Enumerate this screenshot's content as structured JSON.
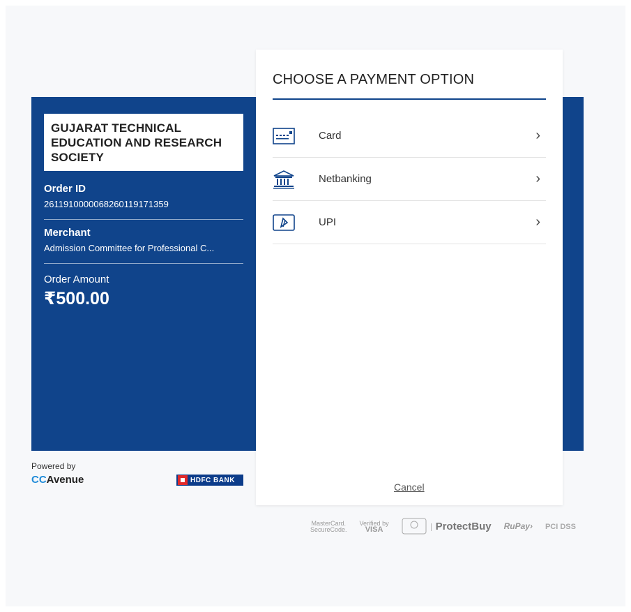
{
  "merchant_box": {
    "name": "GUJARAT TECHNICAL EDUCATION AND RESEARCH SOCIETY"
  },
  "order": {
    "id_label": "Order ID",
    "id_value": "2611910000068260119171359"
  },
  "merchant": {
    "label": "Merchant",
    "value": "Admission Committee for Professional C..."
  },
  "amount": {
    "label": "Order Amount",
    "value": "₹500.00"
  },
  "footer": {
    "powered_by": "Powered by",
    "cc_part": "CC",
    "avenue_part": "Avenue",
    "hdfc": "HDFC BANK"
  },
  "panel": {
    "title": "CHOOSE A PAYMENT OPTION",
    "options": [
      {
        "label": "Card",
        "icon": "card-icon"
      },
      {
        "label": "Netbanking",
        "icon": "bank-icon"
      },
      {
        "label": "UPI",
        "icon": "upi-icon"
      }
    ],
    "cancel": "Cancel"
  },
  "security_logos": {
    "mastercard_l1": "MasterCard.",
    "mastercard_l2": "SecureCode.",
    "visa_l1": "Verified by",
    "visa_l2": "VISA",
    "protectbuy": "ProtectBuy",
    "rupay": "RuPay›",
    "pci": "PCI DSS"
  },
  "colors": {
    "brand_blue": "#10448b",
    "page_bg": "#f7f8fa"
  }
}
